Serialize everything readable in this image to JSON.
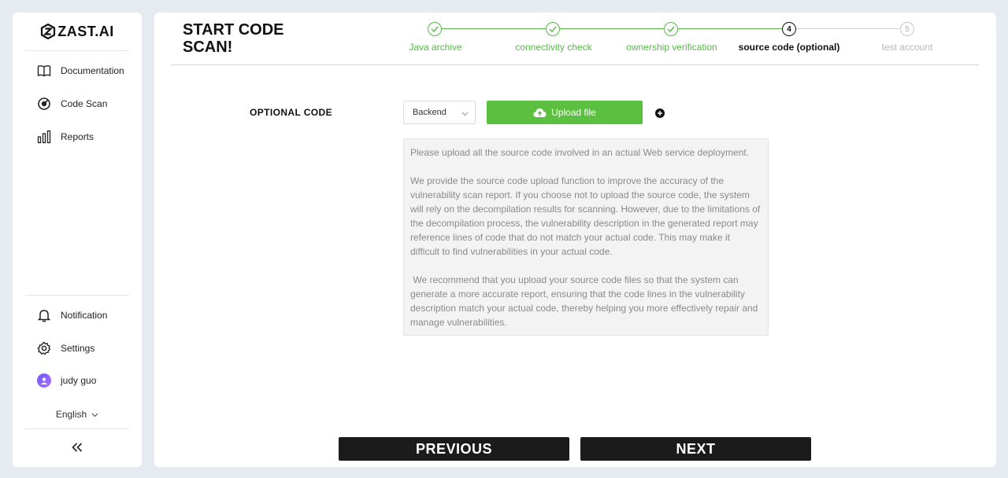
{
  "brand": {
    "name": "ZAST.AI"
  },
  "sidebar": {
    "items": [
      {
        "label": "Documentation",
        "icon": "book-icon"
      },
      {
        "label": "Code Scan",
        "icon": "scan-icon"
      },
      {
        "label": "Reports",
        "icon": "bar-chart-icon"
      }
    ],
    "bottom_items": [
      {
        "label": "Notification",
        "icon": "bell-icon"
      },
      {
        "label": "Settings",
        "icon": "gear-icon"
      },
      {
        "label": "judy guo",
        "icon": "avatar"
      }
    ],
    "language": "English"
  },
  "main": {
    "title": "START CODE SCAN!",
    "steps": [
      {
        "number": "1",
        "label": "Java archive",
        "status": "done"
      },
      {
        "number": "2",
        "label": "connectivity check",
        "status": "done"
      },
      {
        "number": "3",
        "label": "ownership verification",
        "status": "done"
      },
      {
        "number": "4",
        "label": "source code (optional)",
        "status": "active"
      },
      {
        "number": "5",
        "label": "test account",
        "status": "todo"
      }
    ],
    "optional_code_label": "OPTIONAL CODE",
    "select_value": "Backend",
    "upload_label": "Upload file",
    "info_paragraphs": [
      "Please upload all the source code involved in an actual Web service deployment.",
      "We provide the source code upload function to improve the accuracy of the vulnerability scan report. If you choose not to upload the source code, the system will rely on the decompilation results for scanning. However, due to the limitations of the decompilation process, the vulnerability description in the generated report may reference lines of code that do not match your actual code. This may make it difficult to find vulnerabilities in your actual code.",
      " We recommend that you upload your source code files so that the system can generate a more accurate report, ensuring that the code lines in the vulnerability description match your actual code, thereby helping you more effectively repair and manage vulnerabilities."
    ],
    "previous_label": "PREVIOUS",
    "next_label": "NEXT"
  },
  "colors": {
    "accent_green": "#5bbf3f",
    "step_done": "#59b74a",
    "dark_button": "#1b1b1b",
    "background": "#e6ebf1"
  }
}
